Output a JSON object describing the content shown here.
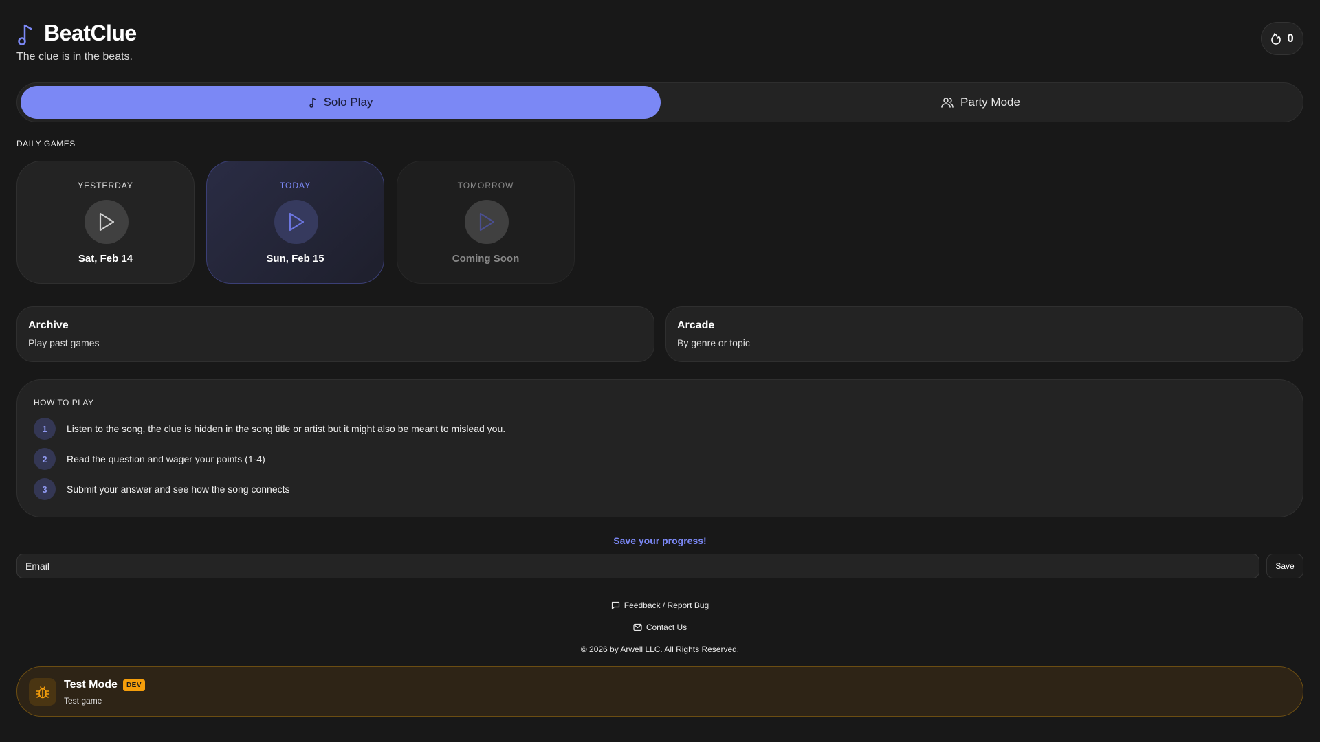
{
  "header": {
    "title": "BeatClue",
    "subtitle": "The clue is in the beats.",
    "streak_count": "0"
  },
  "tabs": [
    {
      "label": "Solo Play",
      "active": true
    },
    {
      "label": "Party Mode",
      "active": false
    }
  ],
  "daily": {
    "label": "DAILY GAMES",
    "cards": [
      {
        "label": "YESTERDAY",
        "date": "Sat, Feb 14"
      },
      {
        "label": "TODAY",
        "date": "Sun, Feb 15"
      },
      {
        "label": "TOMORROW",
        "date": "Coming Soon"
      }
    ]
  },
  "nav": {
    "archive": {
      "title": "Archive",
      "subtitle": "Play past games"
    },
    "arcade": {
      "title": "Arcade",
      "subtitle": "By genre or topic"
    }
  },
  "how_to": {
    "label": "HOW TO PLAY",
    "steps": [
      {
        "num": "1",
        "text": "Listen to the song, the clue is hidden in the song title or artist but it might also be meant to mislead you."
      },
      {
        "num": "2",
        "text": "Read the question and wager your points (1-4)"
      },
      {
        "num": "3",
        "text": "Submit your answer and see how the song connects"
      }
    ]
  },
  "save": {
    "title": "Save your progress!",
    "placeholder": "Email",
    "button": "Save"
  },
  "footer": {
    "feedback": "Feedback / Report Bug",
    "contact": "Contact Us",
    "copyright": "© 2026 by Arwell LLC. All Rights Reserved."
  },
  "banner": {
    "title": "Test Mode",
    "badge": "DEV",
    "subtitle": "Test game"
  },
  "colors": {
    "accent": "#7b88f5",
    "background": "#181818",
    "warning": "#f59e0b"
  }
}
